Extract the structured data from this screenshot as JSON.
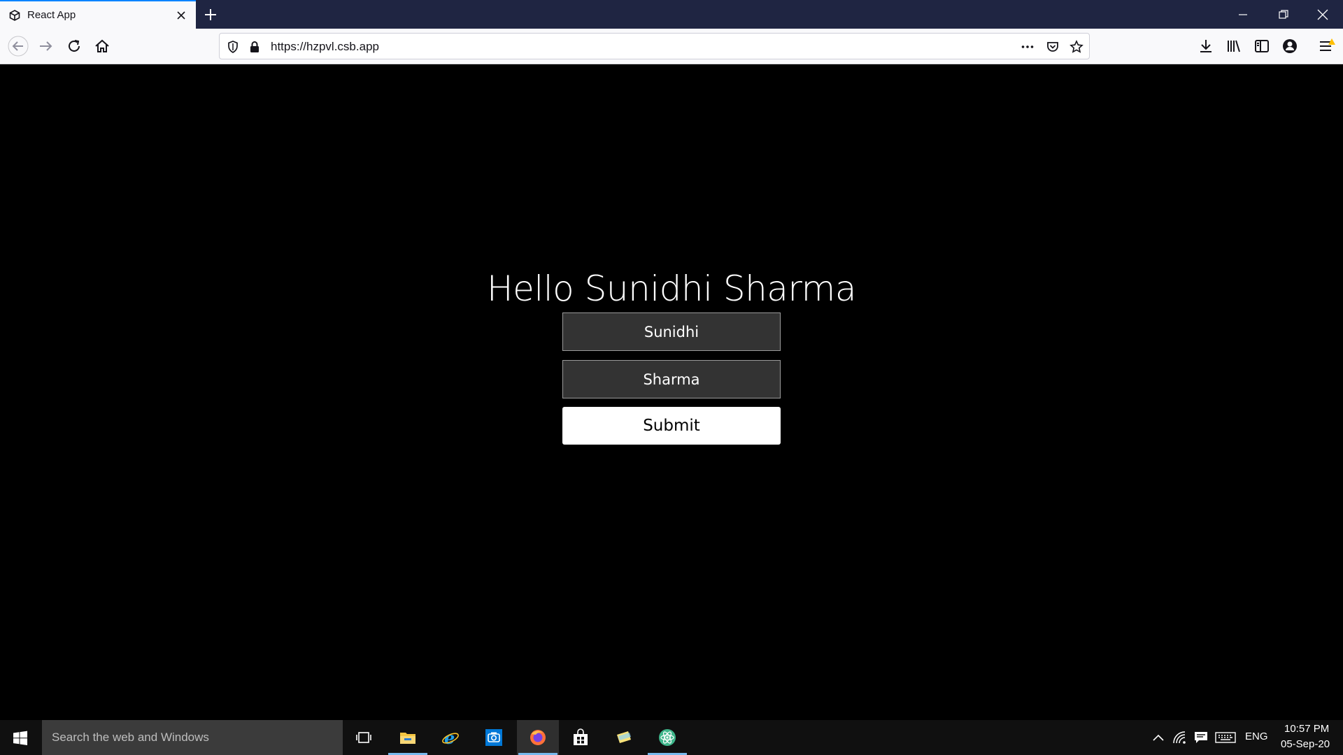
{
  "browser": {
    "tab_title": "React App",
    "url": "https://hzpvl.csb.app"
  },
  "page": {
    "greeting": "Hello Sunidhi Sharma",
    "first_name_value": "Sunidhi",
    "last_name_value": "Sharma",
    "submit_label": "Submit"
  },
  "taskbar": {
    "search_placeholder": "Search the web and Windows",
    "language": "ENG",
    "time": "10:57 PM",
    "date": "05-Sep-20"
  },
  "colors": {
    "page_background": "#000000",
    "tab_accent": "#0a84ff",
    "titlebar": "#1f2542"
  }
}
